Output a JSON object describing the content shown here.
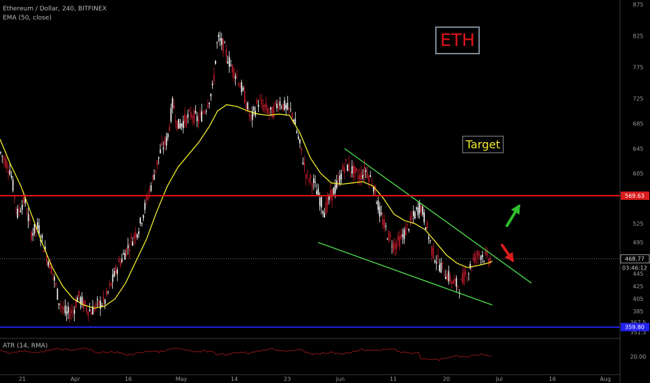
{
  "header": {
    "symbol_line": "Ethereum / Dollar, 240, BITFINEX",
    "ema_line": "EMA (50, close)"
  },
  "atr_label": "ATR (14, RMA)",
  "annotations": {
    "eth": "ETH",
    "target": "Target"
  },
  "colors": {
    "background": "#000000",
    "candle_up": "#ffffff",
    "candle_down": "#c31a2a",
    "ema": "#f2ee2e",
    "channel": "#4fe14f",
    "target_line": "#e31212",
    "support_line": "#2222ee",
    "atr": "#8a1515",
    "arrow_up": "#2fbf2f",
    "arrow_down": "#d81c1c"
  },
  "chart_data": {
    "type": "candlestick",
    "x_ticks": [
      "21",
      "Apr",
      "16",
      "May",
      "14",
      "23",
      "Jun",
      "11",
      "20",
      "Jul",
      "16",
      "Aug"
    ],
    "y_ticks": [
      875,
      825,
      775,
      725,
      685,
      645,
      605,
      525,
      495,
      445,
      425,
      405,
      385,
      367.5,
      351.5
    ],
    "y_range": [
      345,
      880
    ],
    "price_tags": {
      "target": {
        "value": "569.63"
      },
      "current": {
        "value": "468.77"
      },
      "countdown": {
        "value": "03:46:12"
      },
      "support": {
        "value": "359.80"
      }
    },
    "atr_ticks": [
      "20.00"
    ],
    "price_path": [
      [
        0,
        640
      ],
      [
        15,
        610
      ],
      [
        25,
        540
      ],
      [
        35,
        565
      ],
      [
        45,
        510
      ],
      [
        55,
        520
      ],
      [
        65,
        480
      ],
      [
        75,
        450
      ],
      [
        85,
        400
      ],
      [
        95,
        380
      ],
      [
        105,
        385
      ],
      [
        112,
        410
      ],
      [
        120,
        395
      ],
      [
        130,
        385
      ],
      [
        140,
        395
      ],
      [
        150,
        400
      ],
      [
        160,
        430
      ],
      [
        170,
        460
      ],
      [
        180,
        480
      ],
      [
        190,
        500
      ],
      [
        200,
        520
      ],
      [
        210,
        560
      ],
      [
        220,
        600
      ],
      [
        230,
        640
      ],
      [
        240,
        660
      ],
      [
        248,
        720
      ],
      [
        255,
        680
      ],
      [
        265,
        690
      ],
      [
        275,
        700
      ],
      [
        285,
        690
      ],
      [
        295,
        710
      ],
      [
        305,
        740
      ],
      [
        312,
        820
      ],
      [
        320,
        810
      ],
      [
        330,
        780
      ],
      [
        340,
        760
      ],
      [
        350,
        730
      ],
      [
        360,
        690
      ],
      [
        370,
        720
      ],
      [
        380,
        710
      ],
      [
        390,
        700
      ],
      [
        400,
        720
      ],
      [
        410,
        710
      ],
      [
        420,
        700
      ],
      [
        430,
        650
      ],
      [
        440,
        600
      ],
      [
        450,
        590
      ],
      [
        460,
        560
      ],
      [
        465,
        545
      ],
      [
        475,
        570
      ],
      [
        485,
        590
      ],
      [
        495,
        620
      ],
      [
        505,
        610
      ],
      [
        515,
        600
      ],
      [
        525,
        610
      ],
      [
        535,
        590
      ],
      [
        545,
        540
      ],
      [
        555,
        510
      ],
      [
        565,
        490
      ],
      [
        575,
        500
      ],
      [
        585,
        520
      ],
      [
        595,
        540
      ],
      [
        603,
        555
      ],
      [
        612,
        520
      ],
      [
        620,
        480
      ],
      [
        630,
        460
      ],
      [
        640,
        445
      ],
      [
        650,
        430
      ],
      [
        660,
        425
      ],
      [
        665,
        440
      ],
      [
        672,
        450
      ],
      [
        680,
        470
      ],
      [
        688,
        478
      ],
      [
        695,
        472
      ],
      [
        703,
        468.77
      ]
    ],
    "ema_path": [
      [
        0,
        660
      ],
      [
        15,
        620
      ],
      [
        30,
        585
      ],
      [
        45,
        540
      ],
      [
        60,
        495
      ],
      [
        75,
        455
      ],
      [
        90,
        425
      ],
      [
        105,
        405
      ],
      [
        120,
        395
      ],
      [
        135,
        390
      ],
      [
        150,
        393
      ],
      [
        165,
        405
      ],
      [
        180,
        430
      ],
      [
        195,
        465
      ],
      [
        210,
        500
      ],
      [
        225,
        545
      ],
      [
        240,
        585
      ],
      [
        255,
        615
      ],
      [
        270,
        635
      ],
      [
        285,
        655
      ],
      [
        300,
        680
      ],
      [
        312,
        705
      ],
      [
        325,
        715
      ],
      [
        340,
        712
      ],
      [
        355,
        705
      ],
      [
        370,
        700
      ],
      [
        385,
        698
      ],
      [
        400,
        700
      ],
      [
        415,
        698
      ],
      [
        430,
        670
      ],
      [
        445,
        630
      ],
      [
        460,
        605
      ],
      [
        475,
        590
      ],
      [
        490,
        588
      ],
      [
        505,
        590
      ],
      [
        520,
        592
      ],
      [
        535,
        585
      ],
      [
        550,
        565
      ],
      [
        565,
        540
      ],
      [
        580,
        530
      ],
      [
        595,
        525
      ],
      [
        610,
        515
      ],
      [
        625,
        495
      ],
      [
        640,
        475
      ],
      [
        655,
        462
      ],
      [
        670,
        455
      ],
      [
        685,
        458
      ],
      [
        700,
        462
      ],
      [
        706,
        465
      ]
    ],
    "channel_upper": [
      [
        494,
        645
      ],
      [
        762,
        430
      ]
    ],
    "channel_lower": [
      [
        456,
        495
      ],
      [
        706,
        395
      ]
    ]
  }
}
